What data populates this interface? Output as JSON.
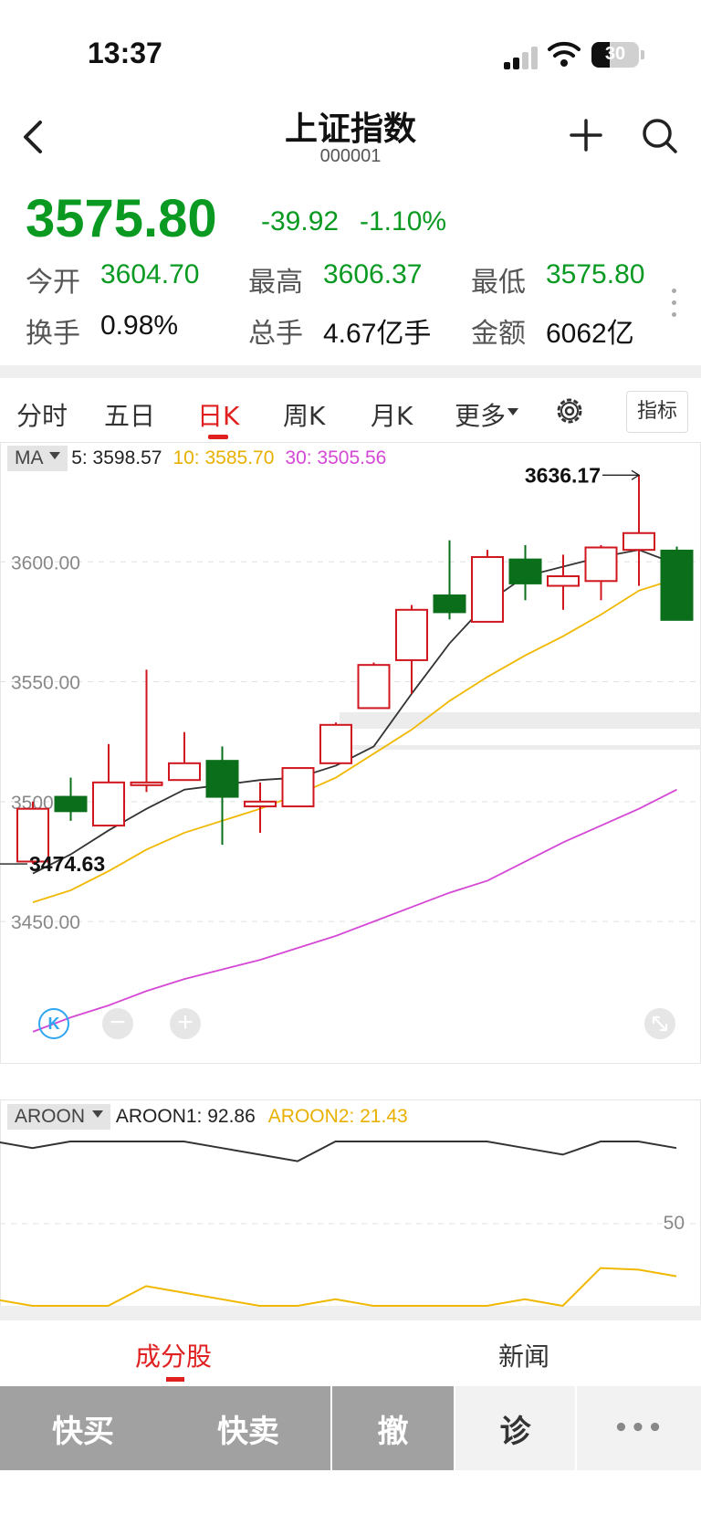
{
  "status_bar": {
    "time": "13:37",
    "battery": "30"
  },
  "header": {
    "title": "上证指数",
    "code": "000001"
  },
  "quote": {
    "price": "3575.80",
    "change": "-39.92",
    "change_pct": "-1.10%",
    "open_label": "今开",
    "open": "3604.70",
    "high_label": "最高",
    "high": "3606.37",
    "low_label": "最低",
    "low": "3575.80",
    "turnover_label": "换手",
    "turnover": "0.98%",
    "volume_label": "总手",
    "volume": "4.67亿手",
    "amount_label": "金额",
    "amount": "6062亿"
  },
  "tabs": [
    "分时",
    "五日",
    "日K",
    "周K",
    "月K",
    "更多"
  ],
  "active_tab": "日K",
  "indicator_button": "指标",
  "ma_legend": {
    "select": "MA",
    "ma5": "5: 3598.57",
    "ma10": "10: 3585.70",
    "ma30": "30: 3505.56"
  },
  "aroon_legend": {
    "select": "AROON",
    "aroon1": "AROON1: 92.86",
    "aroon2": "AROON2: 21.43"
  },
  "chart_controls": {
    "k_label": "K",
    "zoom_out": "−",
    "zoom_in": "+"
  },
  "bottom_tabs": [
    "成分股",
    "新闻"
  ],
  "actions": [
    "快买",
    "快卖",
    "撤",
    "诊",
    "•••"
  ],
  "colors": {
    "up": "#d0161e",
    "down": "#0a6e1a",
    "ma5": "#333333",
    "ma10": "#f0b800",
    "ma30": "#d548d5",
    "price_green": "#0a9a22",
    "accent": "#e02020"
  },
  "chart_data": [
    {
      "type": "candlestick",
      "title": "",
      "y_ticks": [
        "3600.00",
        "3550.00",
        "3500.00",
        "3450.00"
      ],
      "ylim": [
        3391,
        3650
      ],
      "annotations": {
        "max_label": "3636.17",
        "min_label": "3474.63"
      },
      "candles": [
        {
          "o": 3475,
          "c": 3497,
          "h": 3500,
          "l": 3474
        },
        {
          "o": 3502,
          "c": 3496,
          "h": 3510,
          "l": 3492
        },
        {
          "o": 3490,
          "c": 3508,
          "h": 3524,
          "l": 3490
        },
        {
          "o": 3508,
          "c": 3508,
          "h": 3555,
          "l": 3504
        },
        {
          "o": 3509,
          "c": 3516,
          "h": 3529,
          "l": 3509
        },
        {
          "o": 3517,
          "c": 3502,
          "h": 3523,
          "l": 3482
        },
        {
          "o": 3498,
          "c": 3500,
          "h": 3508,
          "l": 3487
        },
        {
          "o": 3498,
          "c": 3514,
          "h": 3514,
          "l": 3498
        },
        {
          "o": 3516,
          "c": 3532,
          "h": 3533,
          "l": 3516
        },
        {
          "o": 3539,
          "c": 3557,
          "h": 3558,
          "l": 3539
        },
        {
          "o": 3559,
          "c": 3580,
          "h": 3582,
          "l": 3545
        },
        {
          "o": 3586,
          "c": 3579,
          "h": 3609,
          "l": 3576
        },
        {
          "o": 3575,
          "c": 3602,
          "h": 3605,
          "l": 3575
        },
        {
          "o": 3601,
          "c": 3591,
          "h": 3607,
          "l": 3584
        },
        {
          "o": 3590,
          "c": 3594,
          "h": 3603,
          "l": 3580
        },
        {
          "o": 3592,
          "c": 3606,
          "h": 3607,
          "l": 3584
        },
        {
          "o": 3605,
          "c": 3612,
          "h": 3636.17,
          "l": 3590
        },
        {
          "o": 3604.7,
          "c": 3575.8,
          "h": 3606.37,
          "l": 3575.8
        }
      ],
      "series": [
        {
          "name": "5",
          "values": [
            3470,
            3478,
            3488,
            3497,
            3505,
            3507,
            3509,
            3510,
            3515,
            3523,
            3545,
            3566,
            3583,
            3594,
            3598,
            3602,
            3605,
            3599
          ]
        },
        {
          "name": "10",
          "values": [
            3458,
            3463,
            3471,
            3480,
            3487,
            3492,
            3497,
            3503,
            3510,
            3520,
            3530,
            3542,
            3552,
            3561,
            3569,
            3578,
            3588,
            3593
          ]
        },
        {
          "name": "30",
          "values": [
            3404,
            3410,
            3415,
            3421,
            3426,
            3430,
            3434,
            3439,
            3444,
            3450,
            3456,
            3462,
            3467,
            3475,
            3483,
            3490,
            3497,
            3505
          ]
        }
      ]
    },
    {
      "type": "line",
      "title": "",
      "y_ticks": [
        "50"
      ],
      "ylim": [
        0,
        110
      ],
      "series": [
        {
          "name": "AROON1",
          "values": [
            100,
            96,
            100,
            100,
            100,
            100,
            96,
            92,
            88,
            100,
            100,
            100,
            100,
            100,
            96,
            92,
            100,
            100,
            96
          ]
        },
        {
          "name": "AROON2",
          "values": [
            4,
            0,
            0,
            0,
            12,
            8,
            4,
            0,
            0,
            4,
            0,
            0,
            0,
            0,
            4,
            0,
            23,
            22,
            18
          ]
        }
      ]
    }
  ]
}
